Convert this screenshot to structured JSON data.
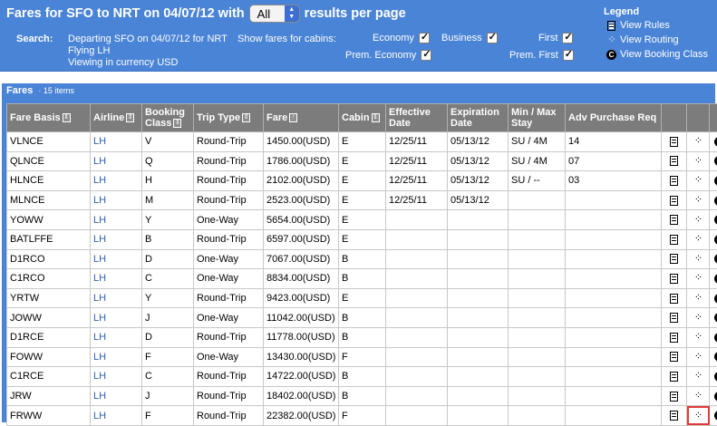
{
  "header": {
    "title_prefix": "Fares for SFO to NRT on 04/07/12 with",
    "per_page_value": "All",
    "title_suffix": "results per page",
    "search_label": "Search:",
    "search_lines": [
      "Departing SFO on 04/07/12 for NRT",
      "Flying LH",
      "Viewing in currency USD"
    ],
    "cabins_label": "Show fares for cabins:",
    "cabins": [
      {
        "label": "Economy",
        "checked": true
      },
      {
        "label": "Business",
        "checked": true
      },
      {
        "label": "First",
        "checked": true
      },
      {
        "label": "Prem. Economy",
        "checked": true
      },
      {
        "label": "Prem. First",
        "checked": true
      }
    ],
    "legend_title": "Legend",
    "legend_items": [
      {
        "icon": "rules-document-icon",
        "label": "View Rules"
      },
      {
        "icon": "routing-icon",
        "label": "View Routing"
      },
      {
        "icon": "booking-class-icon",
        "label": "View Booking Class"
      }
    ]
  },
  "section": {
    "title": "Fares",
    "count": "· 15 items"
  },
  "table": {
    "columns": [
      "Fare Basis",
      "Airline",
      "Booking Class",
      "Trip Type",
      "Fare",
      "Cabin",
      "Effective Date",
      "Expiration Date",
      "Min / Max Stay",
      "Adv Purchase Req"
    ],
    "rows": [
      [
        "VLNCE",
        "LH",
        "V",
        "Round-Trip",
        "1450.00(USD)",
        "E",
        "12/25/11",
        "05/13/12",
        "SU / 4M",
        "14"
      ],
      [
        "QLNCE",
        "LH",
        "Q",
        "Round-Trip",
        "1786.00(USD)",
        "E",
        "12/25/11",
        "05/13/12",
        "SU / 4M",
        "07"
      ],
      [
        "HLNCE",
        "LH",
        "H",
        "Round-Trip",
        "2102.00(USD)",
        "E",
        "12/25/11",
        "05/13/12",
        "SU / --",
        "03"
      ],
      [
        "MLNCE",
        "LH",
        "M",
        "Round-Trip",
        "2523.00(USD)",
        "E",
        "12/25/11",
        "05/13/12",
        "",
        ""
      ],
      [
        "YOWW",
        "LH",
        "Y",
        "One-Way",
        "5654.00(USD)",
        "E",
        "",
        "",
        "",
        ""
      ],
      [
        "BATLFFE",
        "LH",
        "B",
        "Round-Trip",
        "6597.00(USD)",
        "E",
        "",
        "",
        "",
        ""
      ],
      [
        "D1RCO",
        "LH",
        "D",
        "One-Way",
        "7067.00(USD)",
        "B",
        "",
        "",
        "",
        ""
      ],
      [
        "C1RCO",
        "LH",
        "C",
        "One-Way",
        "8834.00(USD)",
        "B",
        "",
        "",
        "",
        ""
      ],
      [
        "YRTW",
        "LH",
        "Y",
        "Round-Trip",
        "9423.00(USD)",
        "E",
        "",
        "",
        "",
        ""
      ],
      [
        "JOWW",
        "LH",
        "J",
        "One-Way",
        "11042.00(USD)",
        "B",
        "",
        "",
        "",
        ""
      ],
      [
        "D1RCE",
        "LH",
        "D",
        "Round-Trip",
        "11778.00(USD)",
        "B",
        "",
        "",
        "",
        ""
      ],
      [
        "FOWW",
        "LH",
        "F",
        "One-Way",
        "13430.00(USD)",
        "F",
        "",
        "",
        "",
        ""
      ],
      [
        "C1RCE",
        "LH",
        "C",
        "Round-Trip",
        "14722.00(USD)",
        "B",
        "",
        "",
        "",
        ""
      ],
      [
        "JRW",
        "LH",
        "J",
        "Round-Trip",
        "18402.00(USD)",
        "B",
        "",
        "",
        "",
        ""
      ],
      [
        "FRWW",
        "LH",
        "F",
        "Round-Trip",
        "22382.00(USD)",
        "F",
        "",
        "",
        "",
        ""
      ]
    ]
  }
}
